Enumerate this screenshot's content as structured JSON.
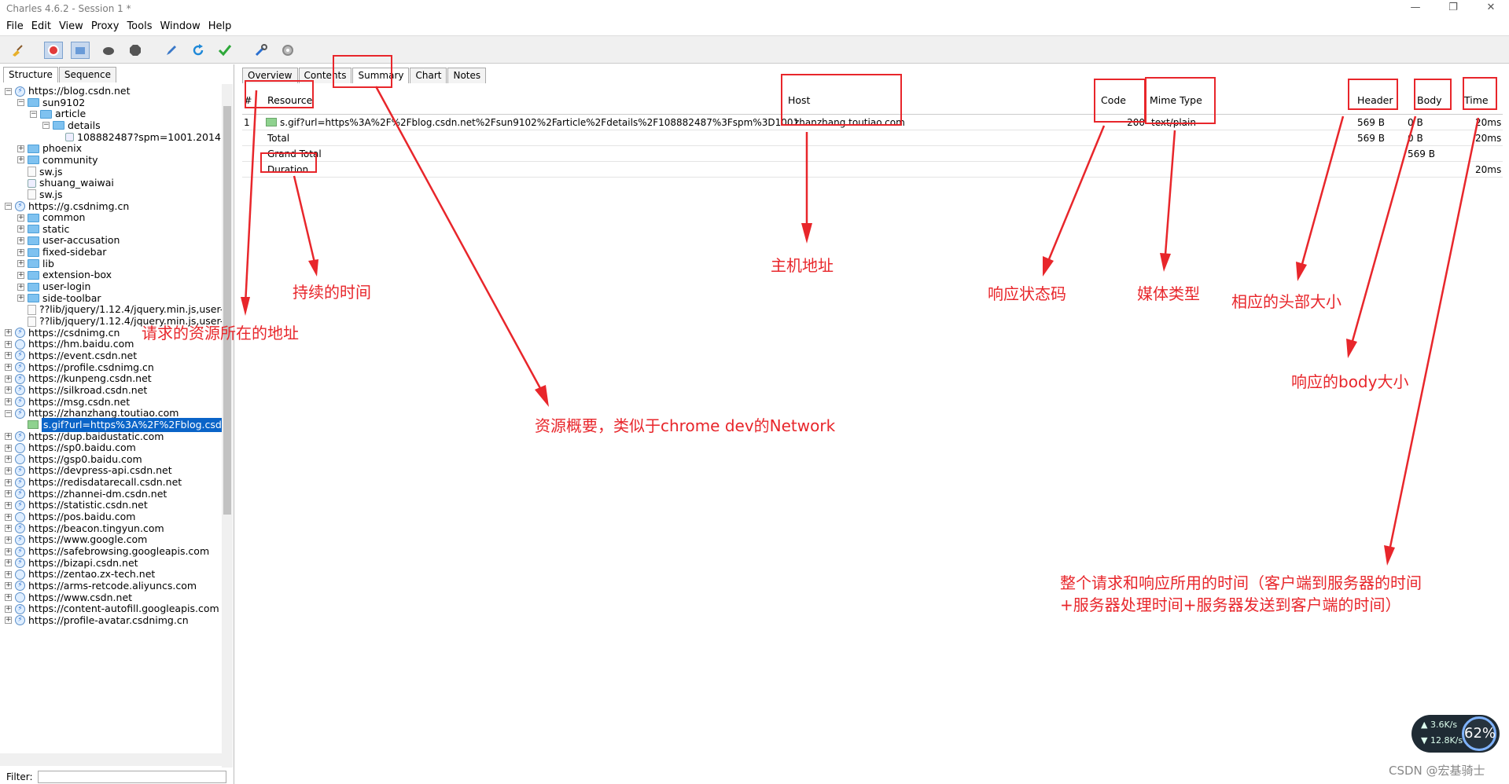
{
  "window": {
    "title": "Charles 4.6.2 - Session 1 *",
    "minimize": "—",
    "maximize": "❐",
    "close": "✕"
  },
  "menu": [
    "File",
    "Edit",
    "View",
    "Proxy",
    "Tools",
    "Window",
    "Help"
  ],
  "toolbar": {
    "icons": [
      "broom-icon",
      "record-icon",
      "throttle-icon",
      "turtle-icon",
      "stop-icon",
      "pen-icon",
      "refresh-icon",
      "check-icon",
      "tools-icon",
      "settings-icon"
    ]
  },
  "left": {
    "tabs": [
      "Structure",
      "Sequence"
    ],
    "tree": [
      {
        "label": "https://blog.csdn.net",
        "exp": "−",
        "icon": "lightning"
      },
      {
        "label": "sun9102",
        "exp": "−",
        "icon": "folder"
      },
      {
        "label": "article",
        "exp": "−",
        "icon": "folder"
      },
      {
        "label": "details",
        "exp": "−",
        "icon": "folder"
      },
      {
        "label": "108882487?spm=1001.2014",
        "exp": "",
        "icon": "dot"
      },
      {
        "label": "phoenix",
        "exp": "+",
        "icon": "folder"
      },
      {
        "label": "community",
        "exp": "+",
        "icon": "folder"
      },
      {
        "label": "sw.js",
        "exp": "",
        "icon": "file"
      },
      {
        "label": "shuang_waiwai",
        "exp": "",
        "icon": "dot"
      },
      {
        "label": "sw.js",
        "exp": "",
        "icon": "file"
      },
      {
        "label": "https://g.csdnimg.cn",
        "exp": "−",
        "icon": "lightning"
      },
      {
        "label": "common",
        "exp": "+",
        "icon": "folder"
      },
      {
        "label": "static",
        "exp": "+",
        "icon": "folder"
      },
      {
        "label": "user-accusation",
        "exp": "+",
        "icon": "folder"
      },
      {
        "label": "fixed-sidebar",
        "exp": "+",
        "icon": "folder"
      },
      {
        "label": "lib",
        "exp": "+",
        "icon": "folder"
      },
      {
        "label": "extension-box",
        "exp": "+",
        "icon": "folder"
      },
      {
        "label": "user-login",
        "exp": "+",
        "icon": "folder"
      },
      {
        "label": "side-toolbar",
        "exp": "+",
        "icon": "folder"
      },
      {
        "label": "??lib/jquery/1.12.4/jquery.min.js,user-l",
        "exp": "",
        "icon": "file"
      },
      {
        "label": "??lib/jquery/1.12.4/jquery.min.js,user-t",
        "exp": "",
        "icon": "file"
      },
      {
        "label": "https://csdnimg.cn",
        "exp": "+",
        "icon": "lightning"
      },
      {
        "label": "https://hm.baidu.com",
        "exp": "+",
        "icon": "globe"
      },
      {
        "label": "https://event.csdn.net",
        "exp": "+",
        "icon": "lightning"
      },
      {
        "label": "https://profile.csdnimg.cn",
        "exp": "+",
        "icon": "lightning"
      },
      {
        "label": "https://kunpeng.csdn.net",
        "exp": "+",
        "icon": "lightning"
      },
      {
        "label": "https://silkroad.csdn.net",
        "exp": "+",
        "icon": "lightning"
      },
      {
        "label": "https://msg.csdn.net",
        "exp": "+",
        "icon": "lightning"
      },
      {
        "label": "https://zhanzhang.toutiao.com",
        "exp": "−",
        "icon": "lightning"
      },
      {
        "label": "s.gif?url=https%3A%2F%2Fblog.csdn.",
        "exp": "",
        "icon": "img",
        "selected": true
      },
      {
        "label": "https://dup.baidustatic.com",
        "exp": "+",
        "icon": "lightning"
      },
      {
        "label": "https://sp0.baidu.com",
        "exp": "+",
        "icon": "globe"
      },
      {
        "label": "https://gsp0.baidu.com",
        "exp": "+",
        "icon": "globe"
      },
      {
        "label": "https://devpress-api.csdn.net",
        "exp": "+",
        "icon": "lightning"
      },
      {
        "label": "https://redisdatarecall.csdn.net",
        "exp": "+",
        "icon": "lightning"
      },
      {
        "label": "https://zhannei-dm.csdn.net",
        "exp": "+",
        "icon": "lightning"
      },
      {
        "label": "https://statistic.csdn.net",
        "exp": "+",
        "icon": "lightning"
      },
      {
        "label": "https://pos.baidu.com",
        "exp": "+",
        "icon": "globe"
      },
      {
        "label": "https://beacon.tingyun.com",
        "exp": "+",
        "icon": "lightning"
      },
      {
        "label": "https://www.google.com",
        "exp": "+",
        "icon": "lightning"
      },
      {
        "label": "https://safebrowsing.googleapis.com",
        "exp": "+",
        "icon": "lightning"
      },
      {
        "label": "https://bizapi.csdn.net",
        "exp": "+",
        "icon": "lightning"
      },
      {
        "label": "https://zentao.zx-tech.net",
        "exp": "+",
        "icon": "globe"
      },
      {
        "label": "https://arms-retcode.aliyuncs.com",
        "exp": "+",
        "icon": "lightning"
      },
      {
        "label": "https://www.csdn.net",
        "exp": "+",
        "icon": "globe"
      },
      {
        "label": "https://content-autofill.googleapis.com",
        "exp": "+",
        "icon": "lightning"
      },
      {
        "label": "https://profile-avatar.csdnimg.cn",
        "exp": "+",
        "icon": "lightning"
      }
    ],
    "filter_label": "Filter:",
    "filter_value": ""
  },
  "right": {
    "tabs": [
      "Overview",
      "Contents",
      "Summary",
      "Chart",
      "Notes"
    ],
    "columns": {
      "num": "#",
      "resource": "Resource",
      "host": "Host",
      "code": "Code",
      "mime": "Mime Type",
      "header": "Header",
      "body": "Body",
      "time": "Time"
    },
    "rows": [
      {
        "num": "1",
        "resource": "s.gif?url=https%3A%2F%2Fblog.csdn.net%2Fsun9102%2Farticle%2Fdetails%2F108882487%3Fspm%3D1001....",
        "host": "zhanzhang.toutiao.com",
        "code": "200",
        "mime": "text/plain",
        "header": "569 B",
        "body": "0 B",
        "time": "20ms"
      },
      {
        "num": "",
        "resource": "Total",
        "host": "",
        "code": "",
        "mime": "",
        "header": "569 B",
        "body": "0 B",
        "time": "20ms"
      },
      {
        "num": "",
        "resource": "Grand Total",
        "host": "",
        "code": "",
        "mime": "",
        "header": "",
        "body": "569 B",
        "time": ""
      },
      {
        "num": "",
        "resource": "Duration",
        "host": "",
        "code": "",
        "mime": "",
        "header": "",
        "body": "",
        "time": "20ms"
      }
    ]
  },
  "annotations": {
    "resource_addr": "请求的资源所在的地址",
    "duration": "持续的时间",
    "summary": "资源概要，类似于chrome dev的Network",
    "host": "主机地址",
    "code": "响应状态码",
    "mime": "媒体类型",
    "header": "相应的头部大小",
    "body": "响应的body大小",
    "time_line1": "整个请求和响应所用的时间（客户端到服务器的时间",
    "time_line2": "+服务器处理时间+服务器发送到客户端的时间）"
  },
  "network_widget": {
    "up": "3.6K/s",
    "down": "12.8K/s",
    "percent": "62%"
  },
  "watermark": "CSDN @宏基骑士",
  "colors": {
    "annotation": "#e8262b",
    "selection": "#0a64c8"
  }
}
